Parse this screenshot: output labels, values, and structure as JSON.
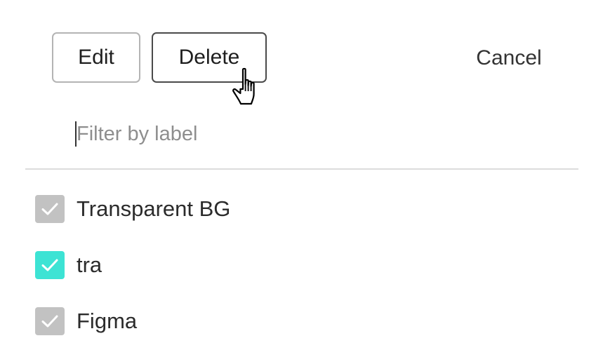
{
  "toolbar": {
    "edit_label": "Edit",
    "delete_label": "Delete",
    "cancel_label": "Cancel"
  },
  "filter": {
    "placeholder": "Filter by label",
    "value": ""
  },
  "labels": [
    {
      "name": "Transparent BG",
      "checked": true,
      "color": "#c2c2c2"
    },
    {
      "name": "tra",
      "checked": true,
      "color": "#3de3d4"
    },
    {
      "name": "Figma",
      "checked": true,
      "color": "#c2c2c2"
    }
  ],
  "cursor": {
    "icon": "hand-pointer-icon"
  }
}
